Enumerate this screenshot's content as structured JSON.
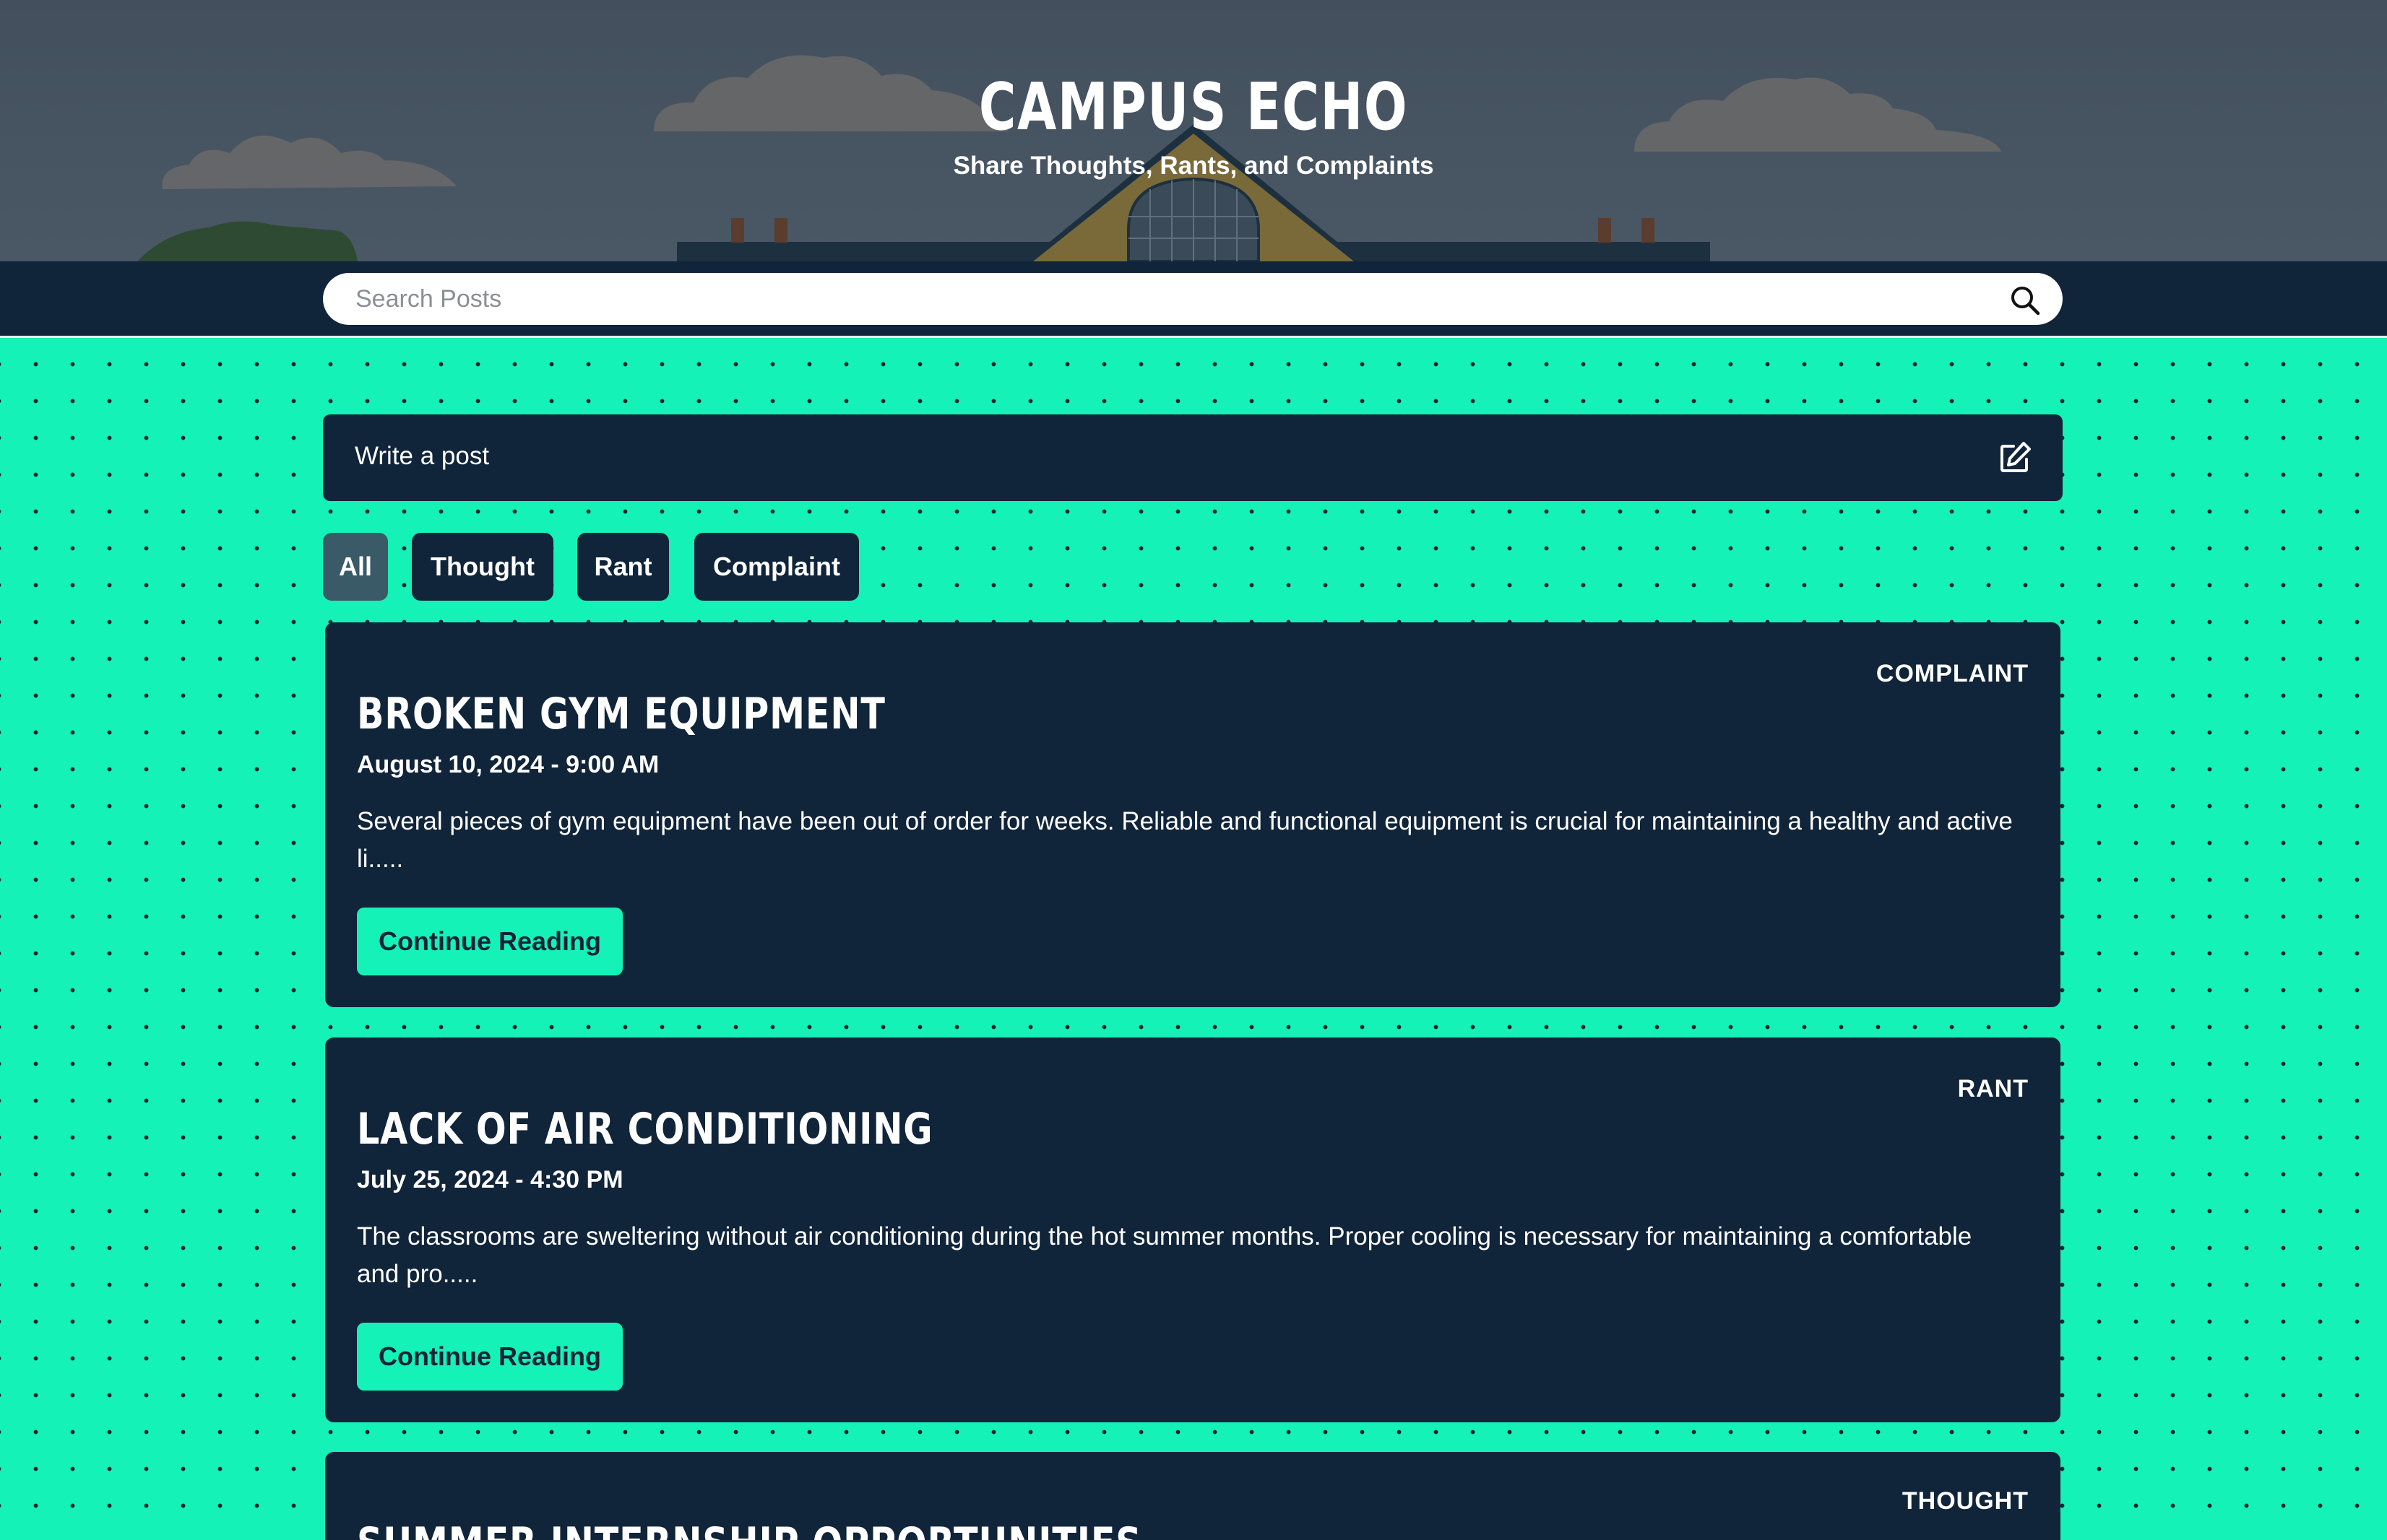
{
  "header": {
    "title": "CAMPUS ECHO",
    "subtitle": "Share Thoughts, Rants, and Complaints"
  },
  "search": {
    "placeholder": "Search Posts",
    "icon": "search-icon"
  },
  "compose": {
    "label": "Write a post",
    "icon": "edit-icon"
  },
  "filters": {
    "items": [
      {
        "label": "All",
        "active": true
      },
      {
        "label": "Thought",
        "active": false
      },
      {
        "label": "Rant",
        "active": false
      },
      {
        "label": "Complaint",
        "active": false
      }
    ]
  },
  "posts": [
    {
      "category": "COMPLAINT",
      "title": "BROKEN GYM EQUIPMENT",
      "date": "August 10, 2024 - 9:00 AM",
      "excerpt": "Several pieces of gym equipment have been out of order for weeks. Reliable and functional equipment is crucial for maintaining a healthy and active li.....",
      "cta": "Continue Reading"
    },
    {
      "category": "RANT",
      "title": "LACK OF AIR CONDITIONING",
      "date": "July 25, 2024 - 4:30 PM",
      "excerpt": "The classrooms are sweltering without air conditioning during the hot summer months. Proper cooling is necessary for maintaining a comfortable and pro.....",
      "cta": "Continue Reading"
    },
    {
      "category": "THOUGHT",
      "title": "SUMMER INTERNSHIP OPPORTUNITIES",
      "date": "",
      "excerpt": "",
      "cta": ""
    }
  ],
  "colors": {
    "accent": "#15f2b7",
    "dark_navy": "#10243a",
    "active_filter": "#3a5a67",
    "header_sky": "#4a5866"
  }
}
